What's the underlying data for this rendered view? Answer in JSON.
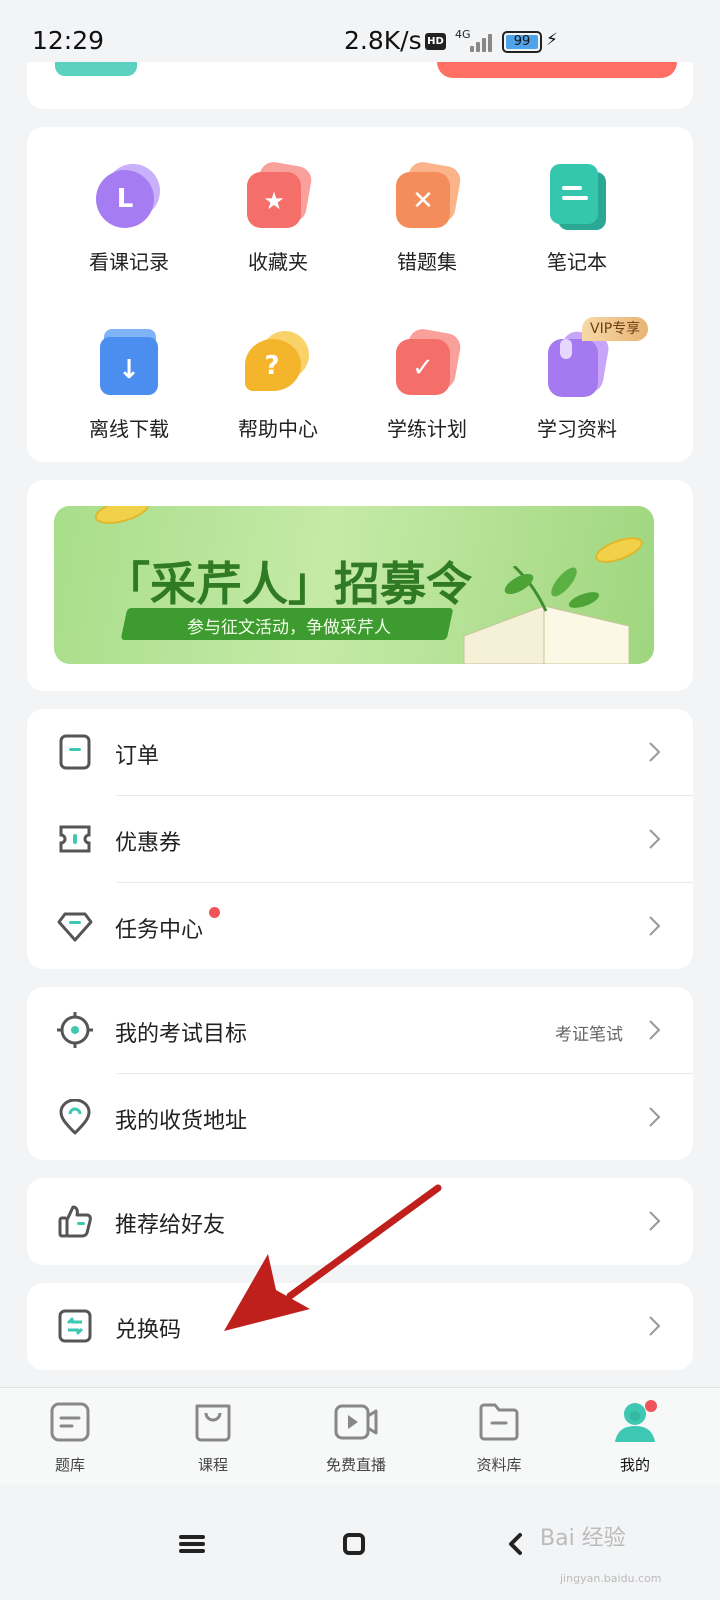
{
  "status_bar": {
    "time": "12:29",
    "speed": "2.8K/s",
    "hd": "HD",
    "network": "4G",
    "battery": "99"
  },
  "grid": {
    "items": [
      {
        "label": "看课记录",
        "icon": "history-clock-icon",
        "color": "#a67cf2"
      },
      {
        "label": "收藏夹",
        "icon": "star-icon",
        "color": "#f46f6a"
      },
      {
        "label": "错题集",
        "icon": "cross-icon",
        "color": "#f58d5a"
      },
      {
        "label": "笔记本",
        "icon": "note-icon",
        "color": "#35c7ad"
      },
      {
        "label": "离线下载",
        "icon": "download-icon",
        "color": "#4b8ef0"
      },
      {
        "label": "帮助中心",
        "icon": "help-icon",
        "color": "#f4b52c"
      },
      {
        "label": "学练计划",
        "icon": "check-icon",
        "color": "#f46f6a"
      },
      {
        "label": "学习资料",
        "icon": "bookmark-icon",
        "color": "#a57af0"
      }
    ],
    "vip_badge": "VIP专享"
  },
  "banner": {
    "title": "「采芹人」招募令",
    "subtitle": "参与征文活动，争做采芹人"
  },
  "menu_orders": {
    "items": [
      {
        "label": "订单",
        "icon": "order-icon"
      },
      {
        "label": "优惠券",
        "icon": "coupon-icon"
      },
      {
        "label": "任务中心",
        "icon": "task-diamond-icon"
      }
    ]
  },
  "menu_goal": {
    "items": [
      {
        "label": "我的考试目标",
        "icon": "target-icon",
        "value": "考证笔试"
      },
      {
        "label": "我的收货地址",
        "icon": "location-icon"
      }
    ]
  },
  "menu_recommend": {
    "label": "推荐给好友",
    "icon": "thumbs-up-icon"
  },
  "menu_redeem": {
    "label": "兑换码",
    "icon": "exchange-icon"
  },
  "tabbar": {
    "items": [
      {
        "label": "题库",
        "icon": "question-bank-icon"
      },
      {
        "label": "课程",
        "icon": "bag-icon"
      },
      {
        "label": "免费直播",
        "icon": "live-video-icon"
      },
      {
        "label": "资料库",
        "icon": "folder-icon"
      },
      {
        "label": "我的",
        "icon": "profile-icon",
        "active": true
      }
    ]
  },
  "watermark": {
    "text": "Bai 经验",
    "url": "jingyan.baidu.com"
  },
  "colors": {
    "accent": "#3ec7b2",
    "arrow": "#c0201c",
    "badge_dot": "#f0545a"
  }
}
